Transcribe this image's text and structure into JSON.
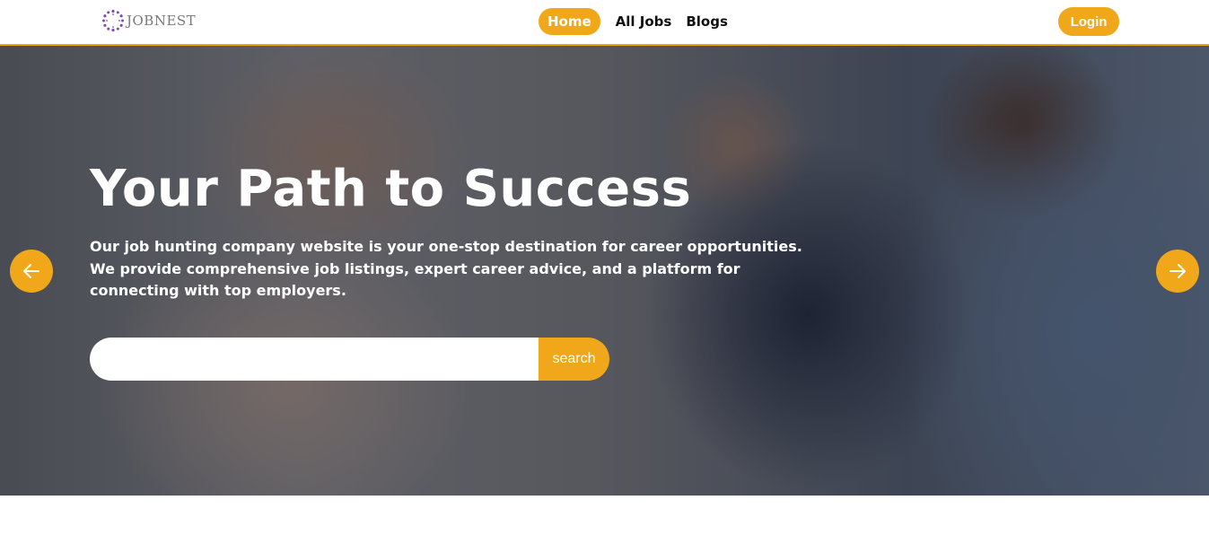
{
  "brand": {
    "name": "JOBNEST",
    "accent": "#f0a81a",
    "logo_color": "#7b4bb5"
  },
  "nav": {
    "items": [
      {
        "label": "Home",
        "active": true
      },
      {
        "label": "All Jobs",
        "active": false
      },
      {
        "label": "Blogs",
        "active": false
      }
    ],
    "login_label": "Login"
  },
  "hero": {
    "title": "Your Path to Success",
    "description": "Our job hunting company website is your one-stop destination for career opportunities. We provide comprehensive job listings, expert career advice, and a platform for connecting with top employers.",
    "search": {
      "value": "",
      "placeholder": "",
      "button_label": "search"
    },
    "prev_icon": "arrow-left-icon",
    "next_icon": "arrow-right-icon"
  }
}
